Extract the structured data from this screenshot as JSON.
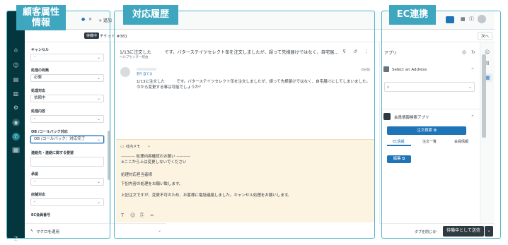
{
  "topbar": {
    "tab_dot": "●",
    "tab_close": "×",
    "add_tab": "+ 追加",
    "apps_icon": "grid-icon",
    "help_icon": "help-icon",
    "next_label": "次へ"
  },
  "subbar": {
    "status_badge": "待機中",
    "ticket_label": "チケット #381"
  },
  "properties": {
    "fields": [
      {
        "label": "キャンセル",
        "value": "-"
      },
      {
        "label": "処理の有無",
        "value": "必要"
      },
      {
        "label": "処理対応",
        "value": "依頼中"
      },
      {
        "label": "処理内容",
        "value": "-"
      },
      {
        "label": "OB /コールバック対応",
        "value": "OB /コールバック：対応完了"
      },
      {
        "label": "連絡先・連絡に関する要望",
        "value": ""
      },
      {
        "label": "承認",
        "value": "-"
      },
      {
        "label": "店舗対応",
        "value": "-"
      },
      {
        "label": "EC会員番号",
        "value": ""
      }
    ]
  },
  "bottom_left": {
    "macro_label": "マクロを適用"
  },
  "conversation": {
    "subject": "1/13に注文した　　　です。バターステイツセレクト缶を注文しましたが、誤って先様届けではなく、自宅届...",
    "channel": "ヘルプセンター経由",
    "sender": "",
    "assign_link": "割り当てる",
    "time": "6分前",
    "body": "1/13に注文した　　　です。バターステイツセレクト缶を注文しましたが、誤って先様届けではなく、自宅届けにしてしまいました。今から変更する事は可能でしょうか？",
    "note_label": "社内メモ",
    "note_lines": [
      "---------- 処理内容確認のお願い ----------",
      "※ここから上は変更しないでください",
      "処理対応担当者様",
      "下記内容の処理をお願い致します。",
      "上記注文ですが、変更不可のため、お客様に電話連絡しました。キャンセル処理をお願いします"
    ],
    "note_end": "。"
  },
  "app": {
    "header": "アプリ",
    "address_title": "Select an Address",
    "address_search_value": "",
    "member_app_title": "会員情報検索アプリ",
    "member_search_button": "注文検索 ⧉",
    "tabs": [
      "EC情報",
      "注文一覧",
      "会員情報"
    ],
    "edit_button": "編集 ⧉"
  },
  "bottom_right": {
    "close_tab_label": "タブを閉じる",
    "submit_label": "待機中として送信",
    "submit_caret": "⌄"
  },
  "overlays": {
    "customer_info": "顧客属性\n情報",
    "conversation_history": "対応履歴",
    "ec_link": "EC連携"
  },
  "colors": {
    "rail": "#03363d",
    "accent": "#1f73b7",
    "overlay": "#3ea6bf",
    "note_bg": "#fdf3e1"
  }
}
